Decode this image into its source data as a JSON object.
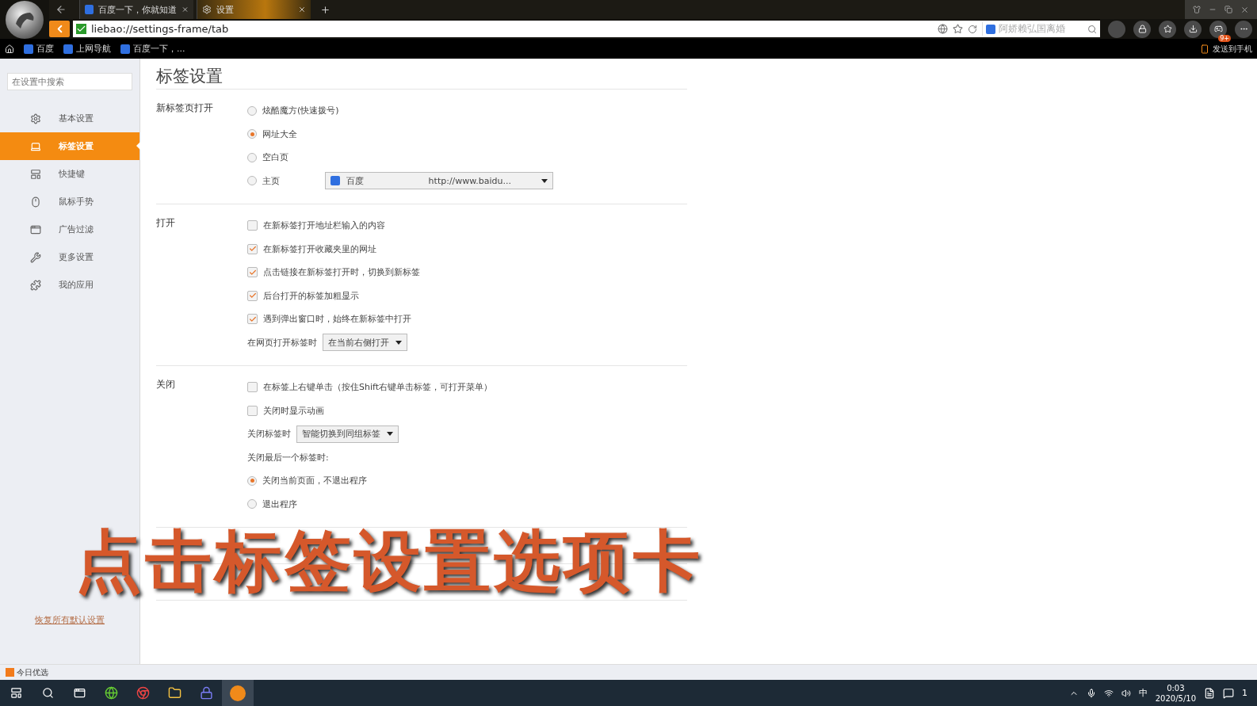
{
  "browser": {
    "tabs": [
      {
        "label": "百度一下，你就知道",
        "selected": false
      },
      {
        "label": "设置",
        "selected": true
      }
    ],
    "address": "liebao://settings-frame/tab",
    "search_placeholder": "阿娇赖弘国离婚",
    "badge": "9+",
    "bookmarks": [
      "百度",
      "上网导航",
      "百度一下，..."
    ],
    "send_to_phone": "发送到手机"
  },
  "sidebar": {
    "search_placeholder": "在设置中搜索",
    "items": [
      {
        "label": "基本设置",
        "selected": false
      },
      {
        "label": "标签设置",
        "selected": true
      },
      {
        "label": "快捷键",
        "selected": false
      },
      {
        "label": "鼠标手势",
        "selected": false
      },
      {
        "label": "广告过滤",
        "selected": false
      },
      {
        "label": "更多设置",
        "selected": false
      },
      {
        "label": "我的应用",
        "selected": false
      }
    ],
    "restore_link": "恢复所有默认设置"
  },
  "page_title": "标签设置",
  "sections": [
    {
      "label": "新标签页打开",
      "items": [
        {
          "kind": "radio",
          "label": "炫酷魔方(快速拨号)",
          "selected": false
        },
        {
          "kind": "radio",
          "label": "网址大全",
          "selected": true
        },
        {
          "kind": "radio",
          "label": "空白页",
          "selected": false
        },
        {
          "kind": "radio",
          "label": "主页",
          "selected": false,
          "select": {
            "name": "百度",
            "url": "http://www.baidu..."
          }
        }
      ]
    },
    {
      "label": "打开",
      "items": [
        {
          "kind": "checkbox",
          "label": "在新标签打开地址栏输入的内容",
          "checked": false
        },
        {
          "kind": "checkbox",
          "label": "在新标签打开收藏夹里的网址",
          "checked": true
        },
        {
          "kind": "checkbox",
          "label": "点击链接在新标签打开时，切换到新标签",
          "checked": true
        },
        {
          "kind": "checkbox",
          "label": "后台打开的标签加粗显示",
          "checked": true
        },
        {
          "kind": "checkbox",
          "label": "遇到弹出窗口时，始终在新标签中打开",
          "checked": true
        },
        {
          "kind": "select",
          "label": "在网页打开标签时",
          "value": "在当前右侧打开"
        }
      ]
    },
    {
      "label": "关闭",
      "items": [
        {
          "kind": "checkbox",
          "label": "在标签上右键单击（按住Shift右键单击标签，可打开菜单）",
          "checked": false
        },
        {
          "kind": "checkbox",
          "label": "关闭时显示动画",
          "checked": false
        },
        {
          "kind": "select",
          "label": "关闭标签时",
          "value": "智能切换到同组标签"
        },
        {
          "kind": "note",
          "label": "关闭最后一个标签时:"
        },
        {
          "kind": "radio",
          "label": "关闭当前页面，不退出程序",
          "selected": true
        },
        {
          "kind": "radio",
          "label": "退出程序",
          "selected": false
        }
      ]
    }
  ],
  "caption": "点击标签设置选项卡",
  "status_bar": {
    "label": "今日优选"
  },
  "taskbar": {
    "ime": "中",
    "time": "0:03",
    "date": "2020/5/10",
    "notifications": "1"
  }
}
